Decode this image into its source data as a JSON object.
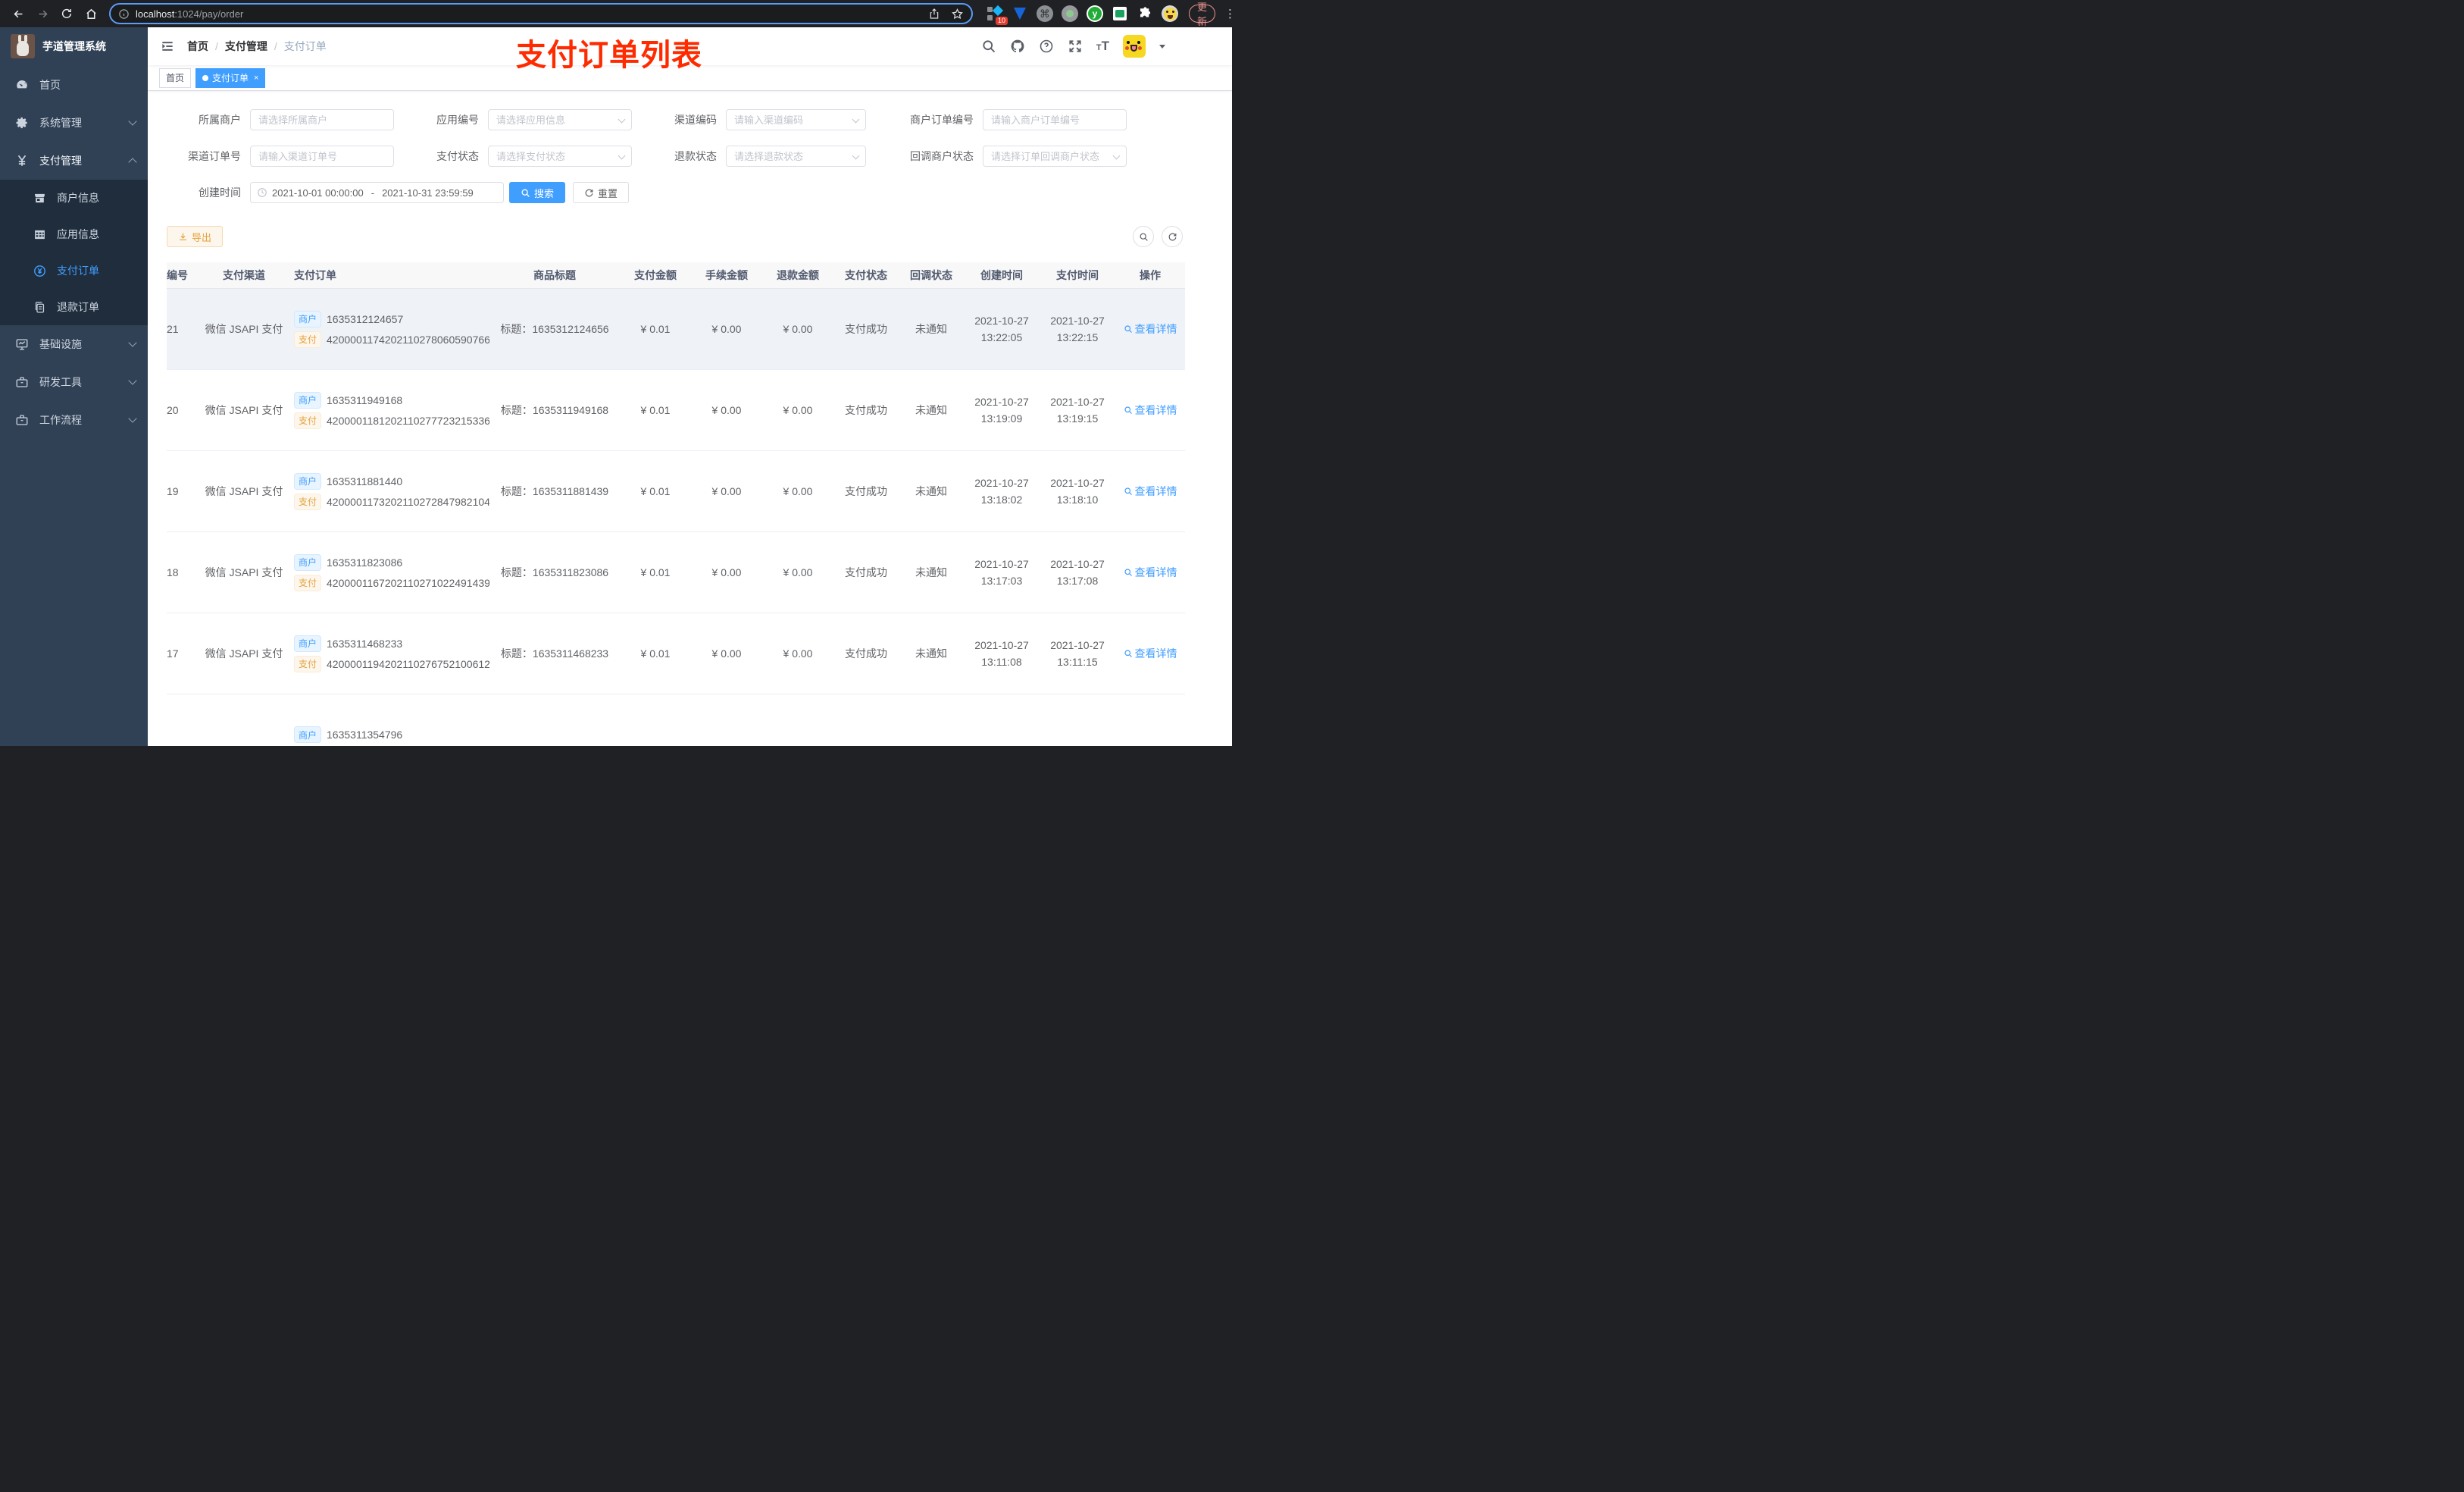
{
  "browser": {
    "url_host": "localhost",
    "url_rest": ":1024/pay/order",
    "ext_badge": "10",
    "ext_y": "y",
    "cmd_glyph": "⌘",
    "update_label": "更新"
  },
  "sidebar": {
    "title": "芋道管理系统",
    "items": {
      "home": "首页",
      "system": "系统管理",
      "pay": "支付管理",
      "merchant": "商户信息",
      "appinfo": "应用信息",
      "payorder": "支付订单",
      "refund": "退款订单",
      "infra": "基础设施",
      "devtool": "研发工具",
      "workflow": "工作流程"
    }
  },
  "header": {
    "breadcrumb": [
      "首页",
      "支付管理",
      "支付订单"
    ],
    "annotation": "支付订单列表"
  },
  "tags": {
    "home": "首页",
    "active": "支付订单",
    "close": "×"
  },
  "filters": {
    "merchant": {
      "label": "所属商户",
      "placeholder": "请选择所属商户"
    },
    "app": {
      "label": "应用编号",
      "placeholder": "请选择应用信息"
    },
    "channel_code": {
      "label": "渠道编码",
      "placeholder": "请输入渠道编码"
    },
    "merchant_order_no": {
      "label": "商户订单编号",
      "placeholder": "请输入商户订单编号"
    },
    "channel_order_no": {
      "label": "渠道订单号",
      "placeholder": "请输入渠道订单号"
    },
    "pay_status": {
      "label": "支付状态",
      "placeholder": "请选择支付状态"
    },
    "refund_status": {
      "label": "退款状态",
      "placeholder": "请选择退款状态"
    },
    "notify_status": {
      "label": "回调商户状态",
      "placeholder": "请选择订单回调商户状态"
    },
    "create_time": {
      "label": "创建时间",
      "start": "2021-10-01 00:00:00",
      "separator": "-",
      "end": "2021-10-31 23:59:59"
    },
    "search_label": "搜索",
    "reset_label": "重置"
  },
  "toolbar": {
    "export_label": "导出"
  },
  "table": {
    "columns": [
      "编号",
      "支付渠道",
      "支付订单",
      "商品标题",
      "支付金额",
      "手续金额",
      "退款金额",
      "支付状态",
      "回调状态",
      "创建时间",
      "支付时间",
      "操作"
    ],
    "merchant_tag": "商户",
    "pay_tag": "支付",
    "rows": [
      {
        "id": "21",
        "channel": "微信 JSAPI 支付",
        "merchant_no": "1635312124657",
        "pay_no": "4200001174202110278060590766",
        "title": "标题：1635312124656",
        "amount": "¥ 0.01",
        "fee": "¥ 0.00",
        "refund": "¥ 0.00",
        "pay_status": "支付成功",
        "notify_status": "未通知",
        "create_date": "2021-10-27",
        "create_clock": "13:22:05",
        "pay_date": "2021-10-27",
        "pay_clock": "13:22:15",
        "action": "查看详情",
        "hover": true
      },
      {
        "id": "20",
        "channel": "微信 JSAPI 支付",
        "merchant_no": "1635311949168",
        "pay_no": "4200001181202110277723215336",
        "title": "标题：1635311949168",
        "amount": "¥ 0.01",
        "fee": "¥ 0.00",
        "refund": "¥ 0.00",
        "pay_status": "支付成功",
        "notify_status": "未通知",
        "create_date": "2021-10-27",
        "create_clock": "13:19:09",
        "pay_date": "2021-10-27",
        "pay_clock": "13:19:15",
        "action": "查看详情"
      },
      {
        "id": "19",
        "channel": "微信 JSAPI 支付",
        "merchant_no": "1635311881440",
        "pay_no": "4200001173202110272847982104",
        "title": "标题：1635311881439",
        "amount": "¥ 0.01",
        "fee": "¥ 0.00",
        "refund": "¥ 0.00",
        "pay_status": "支付成功",
        "notify_status": "未通知",
        "create_date": "2021-10-27",
        "create_clock": "13:18:02",
        "pay_date": "2021-10-27",
        "pay_clock": "13:18:10",
        "action": "查看详情"
      },
      {
        "id": "18",
        "channel": "微信 JSAPI 支付",
        "merchant_no": "1635311823086",
        "pay_no": "4200001167202110271022491439",
        "title": "标题：1635311823086",
        "amount": "¥ 0.01",
        "fee": "¥ 0.00",
        "refund": "¥ 0.00",
        "pay_status": "支付成功",
        "notify_status": "未通知",
        "create_date": "2021-10-27",
        "create_clock": "13:17:03",
        "pay_date": "2021-10-27",
        "pay_clock": "13:17:08",
        "action": "查看详情"
      },
      {
        "id": "17",
        "channel": "微信 JSAPI 支付",
        "merchant_no": "1635311468233",
        "pay_no": "4200001194202110276752100612",
        "title": "标题：1635311468233",
        "amount": "¥ 0.01",
        "fee": "¥ 0.00",
        "refund": "¥ 0.00",
        "pay_status": "支付成功",
        "notify_status": "未通知",
        "create_date": "2021-10-27",
        "create_clock": "13:11:08",
        "pay_date": "2021-10-27",
        "pay_clock": "13:11:15",
        "action": "查看详情"
      },
      {
        "id": "",
        "channel": "",
        "merchant_no": "1635311354796",
        "pay_no": "",
        "title": "",
        "amount": "",
        "fee": "",
        "refund": "",
        "pay_status": "",
        "notify_status": "",
        "create_date": "",
        "create_clock": "",
        "pay_date": "",
        "pay_clock": "",
        "action": ""
      }
    ]
  }
}
